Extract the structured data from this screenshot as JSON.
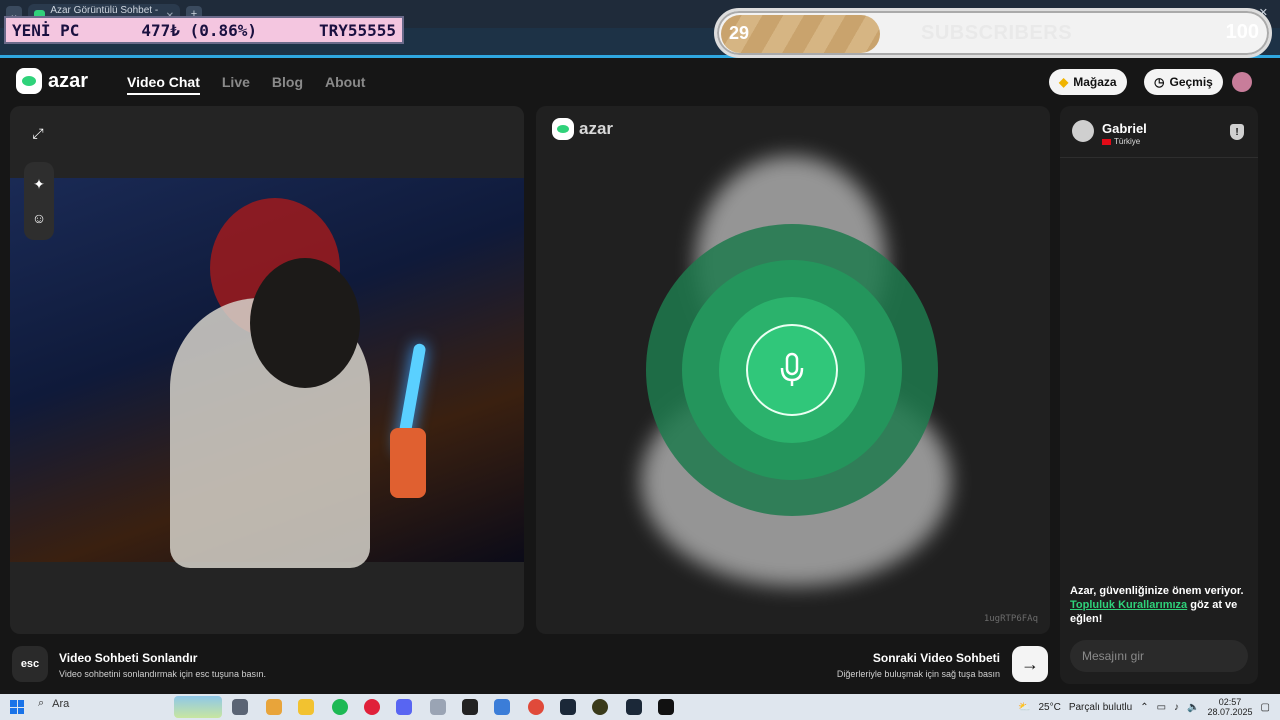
{
  "browser": {
    "tab_title": "Azar Görüntülü Sohbet - A",
    "tab_close": "✕",
    "new_tab": "+",
    "window_controls": [
      "—",
      "▢",
      "✕"
    ]
  },
  "overlay": {
    "ticker_name": "YENİ PC",
    "ticker_value": "477₺ (0.86%)",
    "ticker_code": "TRY55555",
    "subscribers_current": "29",
    "subscribers_label": "SUBSCRIBERS",
    "subscribers_goal": "100",
    "subscribers_progress": 0.29
  },
  "header": {
    "brand": "azar",
    "nav": [
      {
        "label": "Video Chat",
        "active": true
      },
      {
        "label": "Live",
        "active": false
      },
      {
        "label": "Blog",
        "active": false
      },
      {
        "label": "About",
        "active": false
      }
    ],
    "shop_label": "Mağaza",
    "history_label": "Geçmiş"
  },
  "self_panel": {
    "expand_icon": "⤢",
    "sparkle_icon": "✦",
    "face_icon": "☺"
  },
  "partner_panel": {
    "brand": "azar",
    "room_id": "1ugRTP6FAq"
  },
  "chat": {
    "user_name": "Gabriel",
    "user_country": "Türkiye",
    "report_icon": "!",
    "safety_text": "Azar, güvenliğinize önem veriyor.",
    "safety_link": "Topluluk Kurallarımıza",
    "safety_suffix": "göz at ve eğlen!",
    "input_placeholder": "Mesajını gir"
  },
  "bottom": {
    "esc_label": "esc",
    "end_title": "Video Sohbeti Sonlandır",
    "end_sub": "Video sohbetini sonlandırmak için esc tuşuna basın.",
    "next_title": "Sonraki Video Sohbeti",
    "next_sub": "Diğerleriyle buluşmak için sağ tuşa basın",
    "next_arrow": "→"
  },
  "taskbar": {
    "search_label": "Ara",
    "weather_temp": "25°C",
    "weather_text": "Parçalı bulutlu",
    "time": "02:57",
    "date": "28.07.2025"
  },
  "colors": {
    "accent": "#2fd27a",
    "ring_outer": "#1f7a4e",
    "ring_mid": "#24955c",
    "ring_inner": "#2bb26c"
  }
}
